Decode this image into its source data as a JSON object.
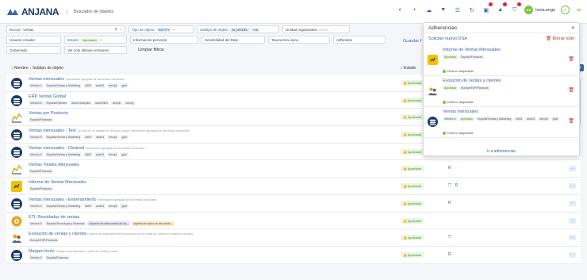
{
  "app": {
    "logo_text": "ANJANA",
    "title": "Buscador de objetos"
  },
  "user": {
    "initials": "LU",
    "name": "lucia.engo"
  },
  "filters": {
    "buscar_label": "Buscar:",
    "buscar_value": "ventas",
    "tipo_label": "Tipo de objeto:",
    "tipo_chip": "ENTITY",
    "subtipo_label": "Subtipo de objeto:",
    "subtipo_chip": "AI_MODEL",
    "subtipo_more": "+16",
    "unidad_label": "Unidad organizativa",
    "unidad_placeholder": "Unida...",
    "usuario_creador": "Usuario creador",
    "estado_label": "Estado:",
    "estado_chip": "Aprobado",
    "info_personal": "Información personal",
    "sensibilidad": "Sensibilidad del Dato",
    "taxonomia": "Taxonomía única",
    "adheridos": "Adheridos",
    "gobernado": "Gobernado",
    "ver_solo": "Ver solo últimas versiones",
    "limpiar": "Limpiar filtros",
    "guardar": "Guardar f"
  },
  "table": {
    "col_nombre": "Nombre",
    "col_subtipo": "Subtipo de objeto",
    "col_estado": "Estado",
    "rows": [
      {
        "title": "Ventas mensuales",
        "desc": "Información agregada de las ventas mensuales",
        "tags": [
          "Versión 4",
          "España/Ventas y Marketing",
          "AWS",
          "aws03",
          "dev/pk",
          "gold"
        ],
        "status": "Aprobado",
        "glyphs": [],
        "icon": "db"
      },
      {
        "title": "ERP Ventas Global",
        "desc": "",
        "tags": [
          "Versión 6",
          "España/Clientes",
          "Azure Analytics",
          "azure/files",
          "dev/pk",
          "survey"
        ],
        "status": "Aprobado",
        "glyphs": [],
        "icon": "db"
      },
      {
        "title": "Ventas por Producto",
        "desc": "",
        "tags": [
          "España/Finanzas"
        ],
        "status": "Aprobado",
        "glyphs": [],
        "icon": "chart"
      },
      {
        "title": "Ventas mensuales - Test",
        "desc": "Se trata de un dataset de Test que incluye: Información agregada de las ventas mensuales.",
        "tags": [
          "Versión 5",
          "España/Ventas y Marketing",
          "AWS",
          "aws03",
          "dev/pk",
          "gold"
        ],
        "status": "Aprobado",
        "glyphs": [],
        "icon": "db"
      },
      {
        "title": "Ventas mensuales - Cleaned",
        "desc": "Información agregada de las ventas mensuales.",
        "tags": [
          "Versión 6",
          "España/Ventas y Marketing",
          "AWS",
          "aws03",
          "dev/pk",
          "gold"
        ],
        "status": "Aprobado",
        "glyphs": [],
        "icon": "db"
      },
      {
        "title": "Ventas Totales Mensuales",
        "desc": "",
        "tags": [
          "España/Finanzas"
        ],
        "status": "Aprobado",
        "glyphs": [
          "R"
        ],
        "icon": "chart"
      },
      {
        "title": "Informe de Ventas Mensuales",
        "desc": "",
        "tags": [
          "España/Finanzas"
        ],
        "status": "Aprobado",
        "glyphs": [
          "⛉",
          "R"
        ],
        "icon": "report"
      },
      {
        "title": "Ventas mensuales - Entrenamiento",
        "desc": "Información agregada de las ventas mensuales.",
        "tags": [
          "Versión 4",
          "España/Ventas y Marketing",
          "AWS",
          "aws03",
          "dev/pk",
          "gold"
        ],
        "status": "Aprobado",
        "glyphs": [
          "R"
        ],
        "icon": "db"
      },
      {
        "title": "ETL Resultados de ventas",
        "desc": "",
        "tags": [
          "Versión 6",
          "España/Tecnología y Sistemas",
          "Acuerdo de intercambio de da...",
          "Ingesta de datos de las fuente..."
        ],
        "status": "Aprobado",
        "glyphs": [],
        "icon": "gear"
      },
      {
        "title": "Evolución de ventas y clientes",
        "desc": "Informe de seguimiento de la evolución de los datos de clientes en distintos periodos",
        "tags": [
          "Europe/ESP/Finanzas"
        ],
        "status": "Aprobado",
        "glyphs": [
          "⛉"
        ],
        "icon": "people"
      },
      {
        "title": "Margen bruto",
        "desc": "Margen bruto calculado a partir de ventas y costes",
        "tags": [
          "Versión 3",
          "España/Finanzas"
        ],
        "status": "Aprobado",
        "glyphs": [
          "R"
        ],
        "icon": "db"
      }
    ]
  },
  "panel": {
    "title": "Adherencias",
    "solicitar": "Solicitar nuevo DSA",
    "borrar": "Borrar todo",
    "footer": "Ir a adherencias",
    "items": [
      {
        "name": "Informe de Ventas Mensuales",
        "tags": [
          "Aprobado",
          "España/Finanzas"
        ],
        "dsa": "DSA no disponible",
        "icon": "report"
      },
      {
        "name": "Evolución de ventas y clientes",
        "tags": [
          "Aprobado",
          "Europe/ESP/Finanzas"
        ],
        "dsa": "DSA no disponible",
        "icon": "people"
      },
      {
        "name": "Ventas mensuales",
        "tags": [
          "Versión 4",
          "Aprobado",
          "España/Ventas y Marketing",
          "AWS",
          "aws03",
          "dev/pk",
          "gold"
        ],
        "dsa": "DSA no disponible",
        "icon": "db"
      }
    ]
  },
  "colors": {
    "primary": "#3b63a8",
    "approved_bg": "#e9f5e0",
    "approved_fg": "#4a8a26",
    "danger": "#c9302c"
  }
}
